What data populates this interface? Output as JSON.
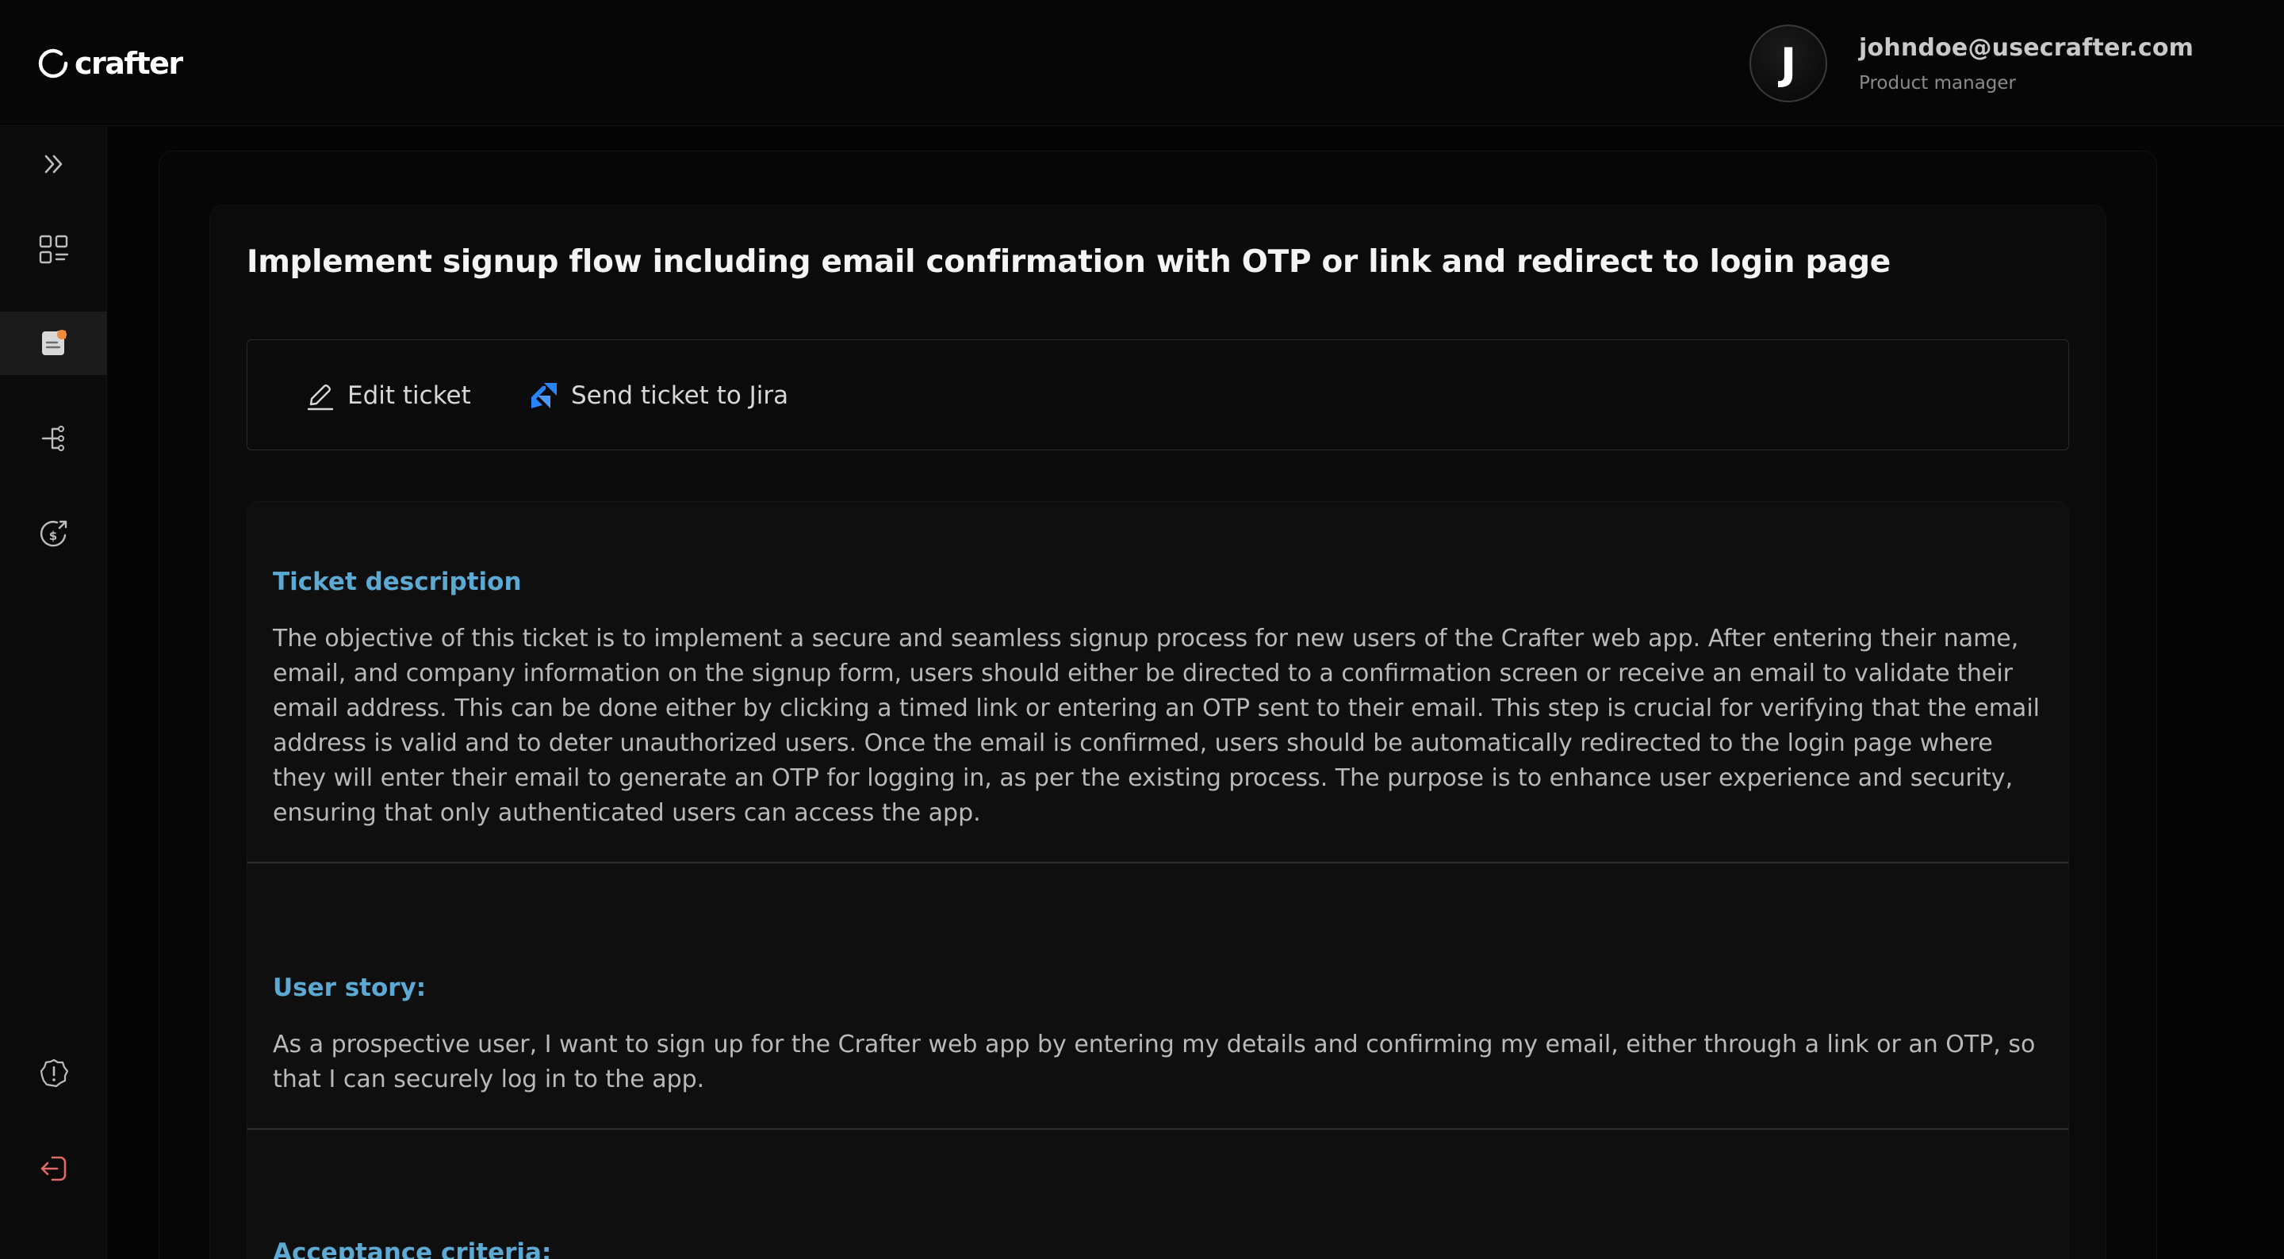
{
  "brand": {
    "name": "crafter"
  },
  "user": {
    "initial": "J",
    "email": "johndoe@usecrafter.com",
    "role": "Product manager"
  },
  "sidebar": {
    "items": [
      {
        "icon": "chevron-double-right-icon"
      },
      {
        "icon": "dashboard-grid-icon"
      },
      {
        "icon": "document-icon",
        "active": true
      },
      {
        "icon": "hierarchy-icon"
      },
      {
        "icon": "dollar-refresh-icon"
      },
      {
        "icon": "alert-icon"
      },
      {
        "icon": "logout-icon"
      }
    ]
  },
  "ticket": {
    "title": "Implement signup flow including email confirmation with OTP or link and redirect to login page",
    "actions": {
      "edit_label": "Edit ticket",
      "jira_label": "Send ticket to Jira"
    },
    "description_heading": "Ticket description",
    "description": "The objective of this ticket is to implement a secure and seamless signup process for new users of the Crafter web app. After entering their name, email, and company information on the signup form, users should either be directed to a confirmation screen or receive an email to validate their email address. This can be done either by clicking a timed link or entering an OTP sent to their email. This step is crucial for verifying that the email address is valid and to deter unauthorized users. Once the email is confirmed, users should be automatically redirected to the login page where they will enter their email to generate an OTP for logging in, as per the existing process. The purpose is to enhance user experience and security, ensuring that only authenticated users can access the app.",
    "user_story_heading": "User story:",
    "user_story": "As a prospective user, I want to sign up for the Crafter web app by entering my details and confirming my email, either through a link or an OTP, so that I can securely log in to the app.",
    "acceptance_heading": "Acceptance criteria:"
  },
  "colors": {
    "accent_heading": "#5ca9d3",
    "jira_blue": "#2684ff",
    "doc_orange": "#f08a3c",
    "logout_red": "#e06a66"
  }
}
